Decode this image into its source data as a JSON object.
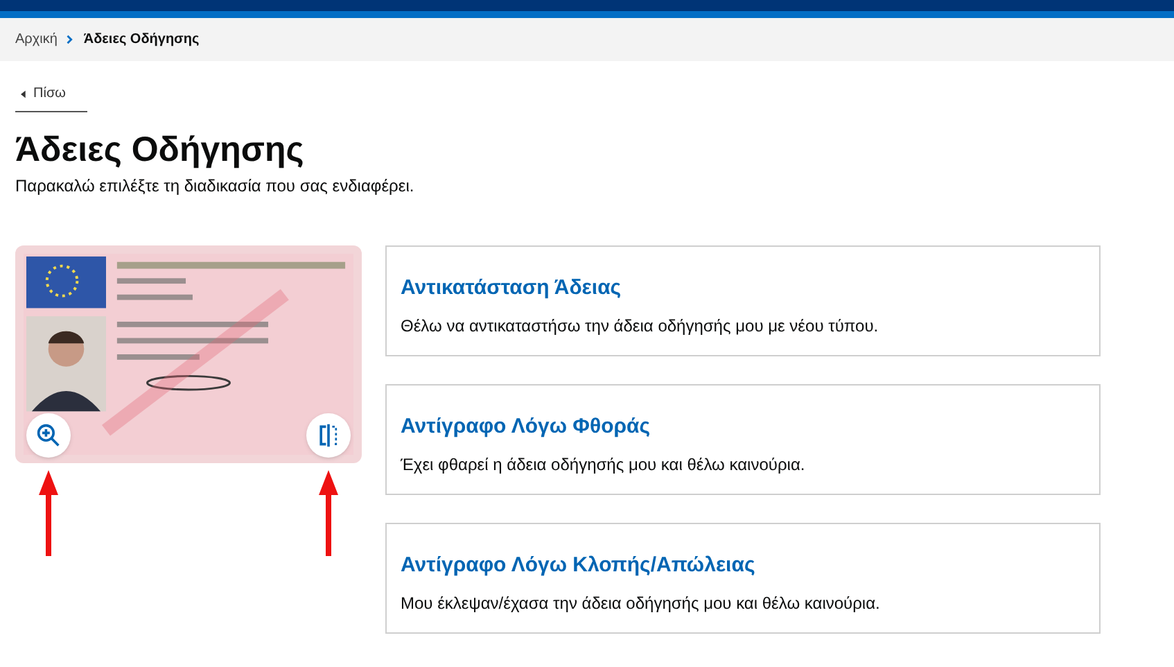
{
  "breadcrumb": [
    {
      "label": "Αρχική",
      "current": false
    },
    {
      "label": "Άδειες Οδήγησης",
      "current": true
    }
  ],
  "back_link": "Πίσω",
  "title": "Άδειες Οδήγησης",
  "subtitle": "Παρακαλώ επιλέξτε τη διαδικασία που σας ενδιαφέρει.",
  "options": [
    {
      "title": "Αντικατάσταση Άδειας",
      "description": "Θέλω να αντικαταστήσω την άδεια οδήγησής μου με νέου τύπου."
    },
    {
      "title": "Αντίγραφο Λόγω Φθοράς",
      "description": "Έχει φθαρεί η άδεια οδήγησής μου και θέλω καινούρια."
    },
    {
      "title": "Αντίγραφο Λόγω Κλοπής/Απώλειας",
      "description": "Μου έκλεψαν/έχασα την άδεια οδήγησής μου και θέλω καινούρια."
    }
  ]
}
